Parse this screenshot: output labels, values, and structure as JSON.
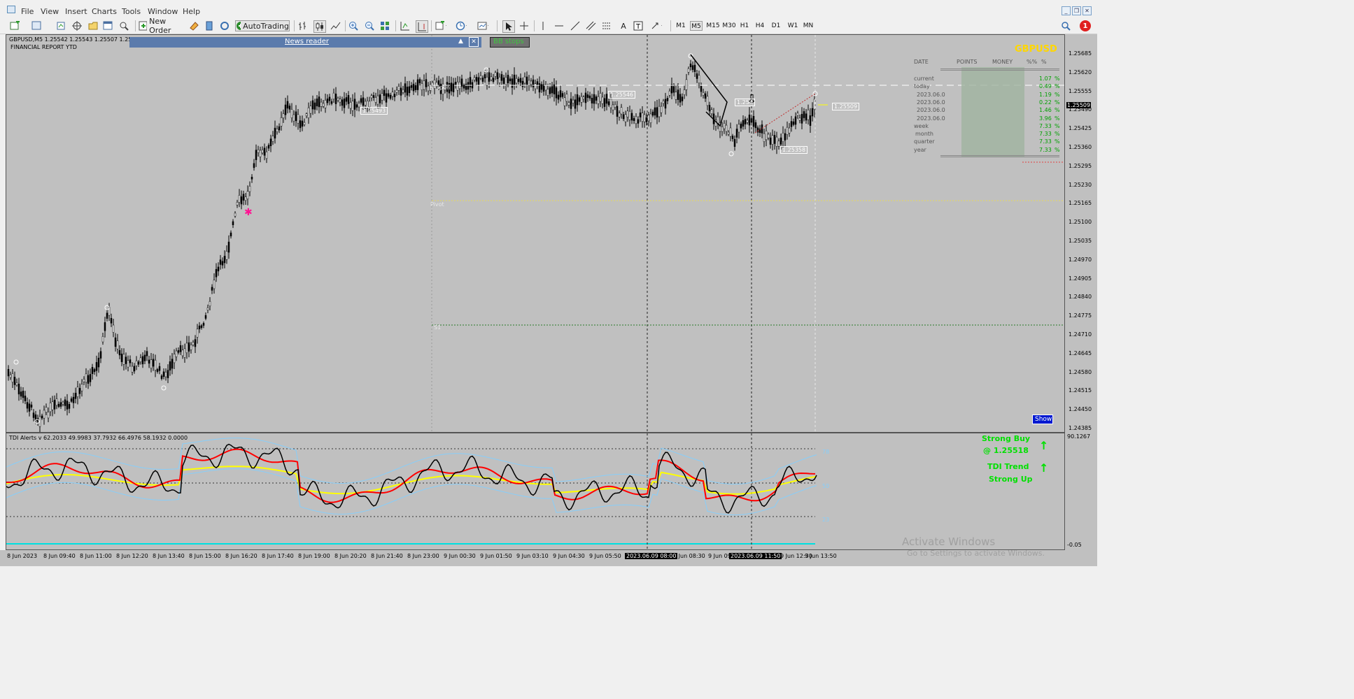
{
  "menu": [
    "File",
    "View",
    "Insert",
    "Charts",
    "Tools",
    "Window",
    "Help"
  ],
  "toolbar": {
    "new_order": "New Order",
    "autotrading": "AutoTrading",
    "timeframes": [
      "M1",
      "M5",
      "M15",
      "M30",
      "H1",
      "H4",
      "D1",
      "W1",
      "MN"
    ],
    "active_timeframe": "M5",
    "notification_count": "1"
  },
  "chart": {
    "symbol_info": "GBPUSD,M5  1.25542 1.25543 1.25507 1.25509",
    "report_title": "FINANCIAL REPORT YTD",
    "news_reader": "News reader",
    "bb_stops": "BB stops",
    "symbol_big": "GBPUSD",
    "current_price": "1.25509",
    "show_button": "Show",
    "labels": {
      "open": "s Open",
      "pivot": "Pivot",
      "s1": "S1"
    },
    "price_tags": [
      "1.25493",
      "1.25546",
      "1.254",
      "1.25358",
      "1.25509"
    ],
    "price_ticks": [
      "1.25685",
      "1.25620",
      "1.25555",
      "1.25490",
      "1.25425",
      "1.25360",
      "1.25295",
      "1.25230",
      "1.25165",
      "1.25100",
      "1.25035",
      "1.24970",
      "1.24905",
      "1.24840",
      "1.24775",
      "1.24710",
      "1.24645",
      "1.24580",
      "1.24515",
      "1.24450",
      "1.24385"
    ]
  },
  "report": {
    "headers": [
      "DATE",
      "POINTS",
      "MONEY",
      "%%",
      "%"
    ],
    "rows": [
      {
        "date": "current",
        "pct": "1.07",
        "unit": "%"
      },
      {
        "date": "today",
        "pct": "0.49",
        "unit": "%"
      },
      {
        "date": "2023.06.0",
        "pct": "1.19",
        "unit": "%"
      },
      {
        "date": "2023.06.0",
        "pct": "0.22",
        "unit": "%"
      },
      {
        "date": "2023.06.0",
        "pct": "1.46",
        "unit": "%"
      },
      {
        "date": "2023.06.0",
        "pct": "3.96",
        "unit": "%"
      },
      {
        "date": "week",
        "pct": "7.33",
        "unit": "%"
      },
      {
        "date": "month",
        "pct": "7.33",
        "unit": "%"
      },
      {
        "date": "quarter",
        "pct": "7.33",
        "unit": "%"
      },
      {
        "date": "year",
        "pct": "7.33",
        "unit": "%"
      }
    ]
  },
  "indicator": {
    "title": "TDI Alerts v 62.2033 49.9983 37.7932 66.4976 58.1932 0.0000",
    "signal_line1": "Strong Buy",
    "signal_line2": "@ 1.25518",
    "trend_line1": "TDI Trend",
    "trend_line2": "Strong Up",
    "levels": [
      "78",
      "50",
      "23"
    ],
    "scale_top": "90.1267",
    "scale_bottom": "-0.05"
  },
  "time_axis": [
    "8 Jun 2023",
    "8 Jun 09:40",
    "8 Jun 11:00",
    "8 Jun 12:20",
    "8 Jun 13:40",
    "8 Jun 15:00",
    "8 Jun 16:20",
    "8 Jun 17:40",
    "8 Jun 19:00",
    "8 Jun 20:20",
    "8 Jun 21:40",
    "8 Jun 23:00",
    "9 Jun 00:30",
    "9 Jun 01:50",
    "9 Jun 03:10",
    "9 Jun 04:30",
    "9 Jun 05:50",
    "9 Jun 08:30",
    "9 Jun 09:50",
    "9 Jun 12:30",
    "9 Jun 13:50"
  ],
  "crosshair_times": [
    "2023.06.09 08:00",
    "2023.06.09 11:50"
  ],
  "watermark": {
    "line1": "Activate Windows",
    "line2": "Go to Settings to activate Windows."
  },
  "colors": {
    "chart_bg": "#c0c0c0",
    "ma_red": "#ff0000",
    "ma_yellow": "#ffff00",
    "band_blue": "#87cefa",
    "signal_green": "#00ff00",
    "symbol_gold": "#ffd700",
    "positive_green": "#00a000"
  }
}
